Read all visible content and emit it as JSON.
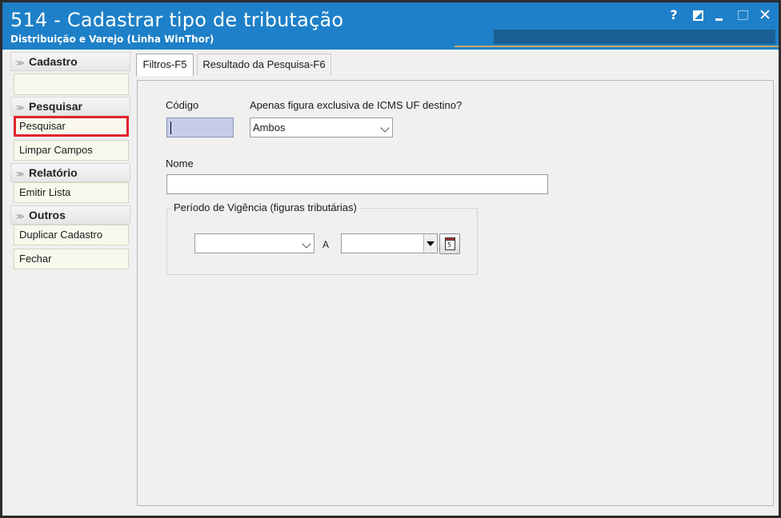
{
  "window": {
    "title": "514 - Cadastrar tipo de tributação",
    "subtitle": "Distribuição e Varejo (Linha WinThor)",
    "controls": {
      "help": "?",
      "close": "✕"
    }
  },
  "sidebar": {
    "sections": {
      "cadastro": {
        "label": "Cadastro"
      },
      "pesquisar": {
        "label": "Pesquisar",
        "items": {
          "pesquisar": "Pesquisar",
          "limpar": "Limpar Campos"
        }
      },
      "relatorio": {
        "label": "Relatório",
        "items": {
          "emitir": "Emitir Lista"
        }
      },
      "outros": {
        "label": "Outros",
        "items": {
          "duplicar": "Duplicar Cadastro",
          "fechar": "Fechar"
        }
      }
    }
  },
  "tabs": {
    "filtros": "Filtros-F5",
    "resultado": "Resultado da Pesquisa-F6"
  },
  "form": {
    "codigo": {
      "label": "Código",
      "value": ""
    },
    "icms": {
      "label": "Apenas figura exclusiva de ICMS UF destino?",
      "selected": "Ambos"
    },
    "nome": {
      "label": "Nome",
      "value": ""
    },
    "periodo": {
      "legend": "Período de Vigência (figuras tributárias)",
      "separator": "A",
      "calendar_day": "5",
      "from": "",
      "to": ""
    }
  },
  "colors": {
    "title_bar": "#1e80c8",
    "highlight_border": "#e0242b",
    "sidebar_item_bg": "#f9f8ed",
    "codigo_field_bg": "#c6cdea"
  },
  "icons": {
    "section_chevron": "double-chevron-down-icon",
    "dropdown": "chevron-down-icon",
    "calendar": "calendar-icon"
  }
}
